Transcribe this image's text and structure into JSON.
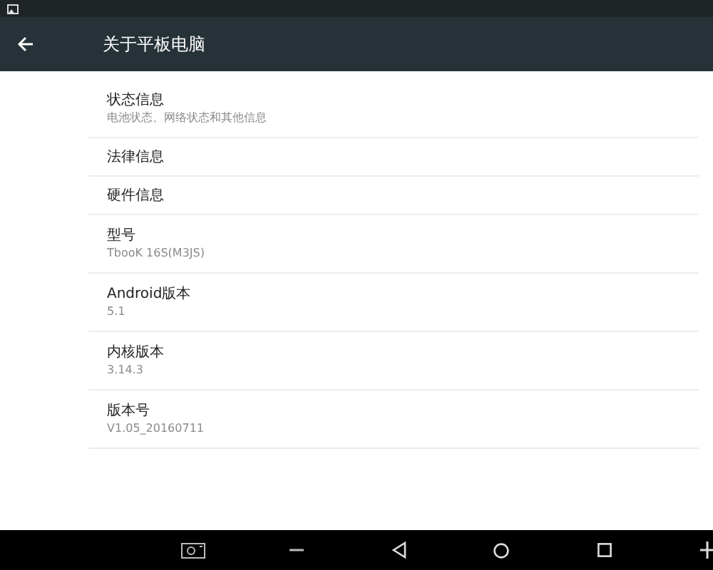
{
  "toolbar": {
    "title": "关于平板电脑"
  },
  "items": [
    {
      "title": "状态信息",
      "summary": "电池状态、网络状态和其他信息"
    },
    {
      "title": "法律信息"
    },
    {
      "title": "硬件信息"
    },
    {
      "title": "型号",
      "summary": "TbooK 16S(M3JS)"
    },
    {
      "title": "Android版本",
      "summary": "5.1"
    },
    {
      "title": "内核版本",
      "summary": "3.14.3"
    },
    {
      "title": "版本号",
      "summary": "V1.05_20160711"
    }
  ]
}
